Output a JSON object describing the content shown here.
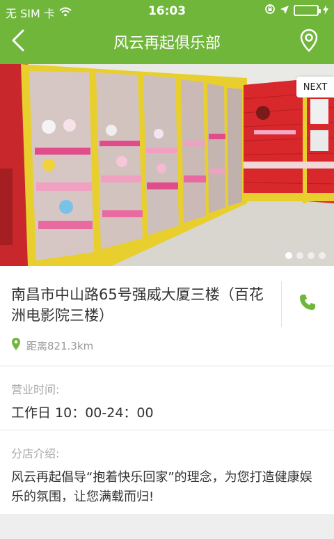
{
  "status_bar": {
    "carrier": "无 SIM 卡",
    "time": "16:03"
  },
  "nav": {
    "title": "风云再起俱乐部",
    "back_icon": "chevron-left-icon",
    "location_icon": "map-pin-icon"
  },
  "hero": {
    "next_label": "NEXT",
    "slide_count": 4,
    "active_slide": 0
  },
  "address": {
    "text": "南昌市中山路65号强威大厦三楼（百花洲电影院三楼）",
    "phone_icon": "phone-icon",
    "distance_label": "距离821.3km"
  },
  "hours": {
    "label": "营业时间:",
    "value": "工作日 10：00-24：00"
  },
  "intro": {
    "label": "分店介绍:",
    "text": "风云再起倡导“抱着快乐回家”的理念，为您打造健康娱乐的氛围，让您满载而归!"
  },
  "colors": {
    "brand_green": "#6fb63b",
    "icon_green": "#6fb63b"
  }
}
